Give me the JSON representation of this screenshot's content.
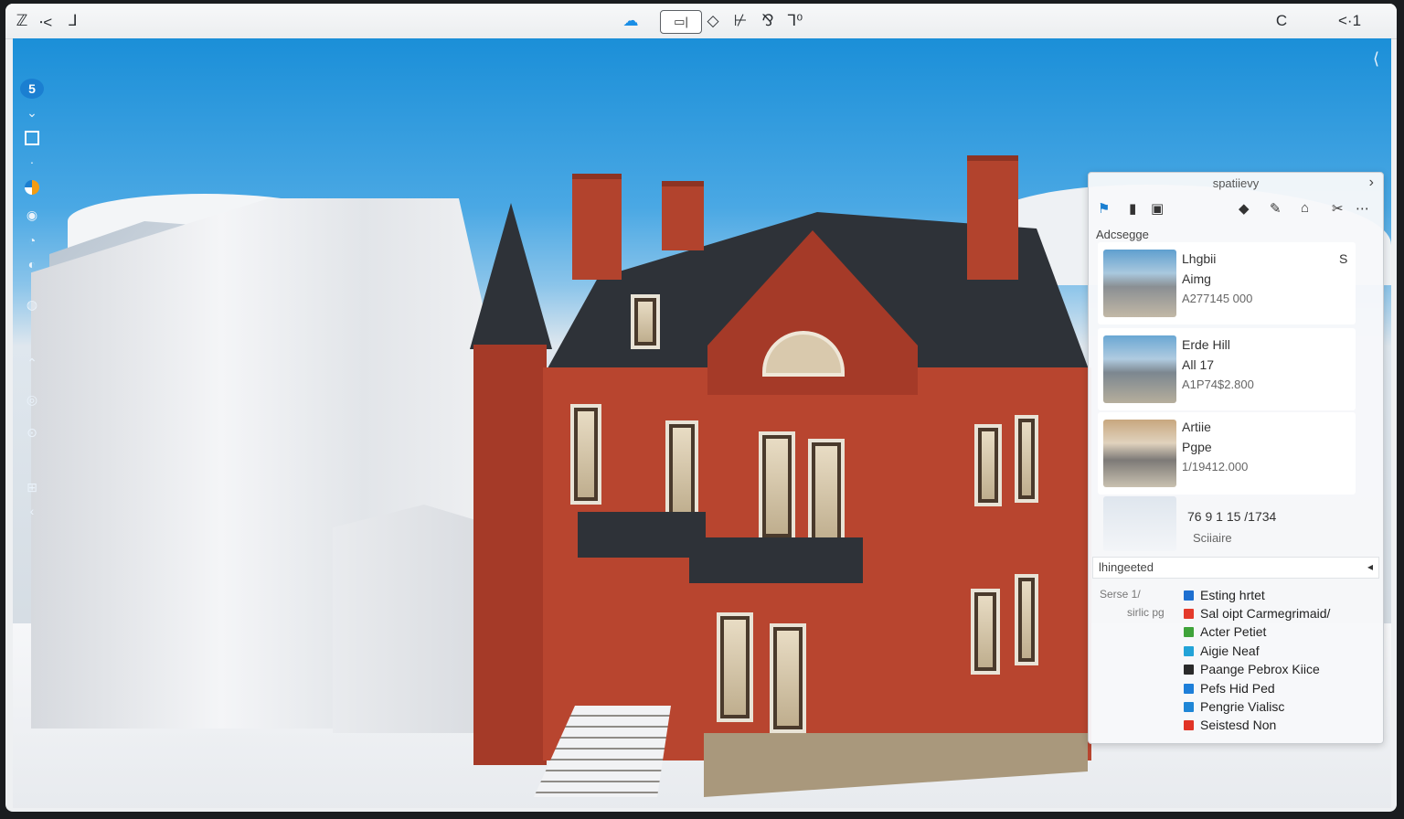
{
  "toolbar": {
    "left_icons": [
      "ℤ",
      "⸱<",
      "⅃"
    ],
    "center_group_label": "▭|",
    "center_icons": [
      "◇",
      "⊬",
      "⅋",
      "⅂⁰"
    ],
    "right_icons": [
      "C",
      "<·1"
    ]
  },
  "rail": {
    "top_badge": "5"
  },
  "panel": {
    "title": "spatiievy",
    "close_glyph": "›",
    "assets_label": "Adcsegge",
    "assets": [
      {
        "title": "Lhgbii",
        "subtitle": "Aimg",
        "meta": "A277145 000",
        "flag": "S"
      },
      {
        "title": "Erde Hill",
        "subtitle": "All 17",
        "meta": "A1P74$2.800",
        "flag": ""
      },
      {
        "title": "Artiie",
        "subtitle": "Pgpe",
        "meta": "1/19412.000",
        "flag": ""
      },
      {
        "title": "76 9 1 15 /1734",
        "subtitle": "Sciiaire",
        "meta": "",
        "flag": ""
      }
    ],
    "layers_label": "lhingeeted",
    "layers_side": [
      "Serse 1/",
      "sirlic pg"
    ],
    "layers": [
      {
        "label": "Esting hrtet",
        "color": "#1e6fd0"
      },
      {
        "label": "Sal oipt Carmegrimaid/",
        "color": "#e43a2b"
      },
      {
        "label": "Acter Petiet",
        "color": "#3fa33a"
      },
      {
        "label": "Aigie Neaf",
        "color": "#23a3d8"
      },
      {
        "label": "Paange Pebrox Kiice",
        "color": "#2a2a2a"
      },
      {
        "label": "Pefs Hid Ped",
        "color": "#1e7fd9"
      },
      {
        "label": "Pengrie Vialisc",
        "color": "#1f86d6"
      },
      {
        "label": "Seistesd Non",
        "color": "#e13325"
      }
    ]
  }
}
